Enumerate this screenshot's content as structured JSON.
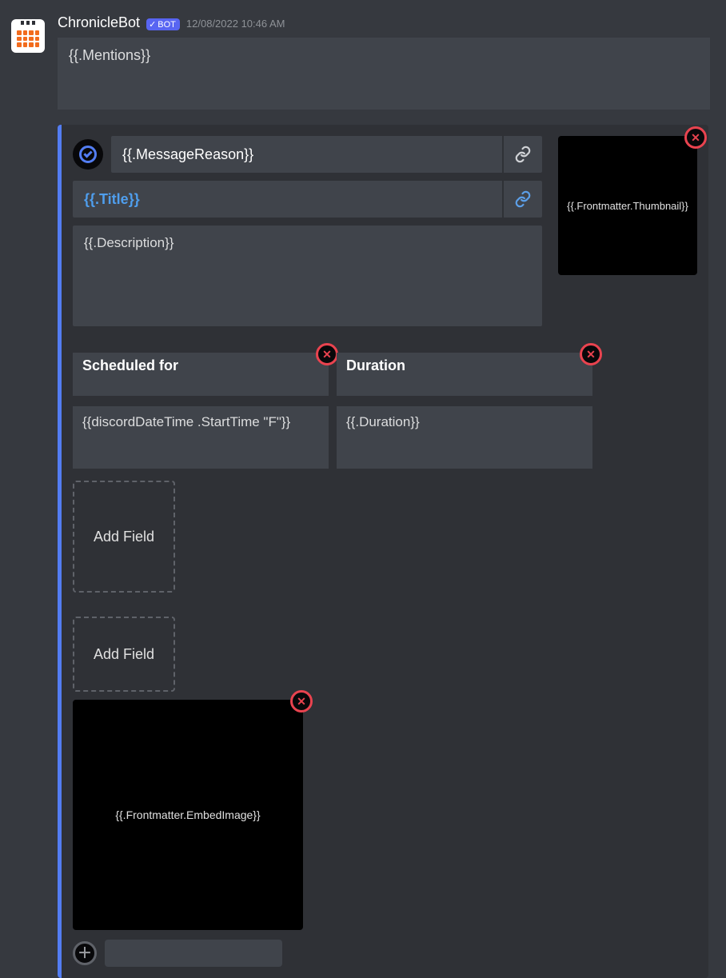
{
  "author": {
    "name": "ChronicleBot",
    "bot_label": "BOT"
  },
  "timestamp": "12/08/2022 10:46 AM",
  "content_input": "{{.Mentions}}",
  "embed": {
    "author_text": "{{.MessageReason}}",
    "title_text": "{{.Title}}",
    "description": "{{.Description}}",
    "thumbnail_label": "{{.Frontmatter.Thumbnail}}",
    "fields": [
      {
        "name": "Scheduled for",
        "value": "{{discordDateTime .StartTime \"F\"}}"
      },
      {
        "name": "Duration",
        "value": "{{.Duration}}"
      }
    ],
    "add_field_label": "Add Field",
    "image_label": "{{.Frontmatter.EmbedImage}}"
  },
  "icons": {
    "link": "link-icon",
    "close": "close-icon",
    "plus": "plus-icon",
    "check": "check-icon"
  }
}
